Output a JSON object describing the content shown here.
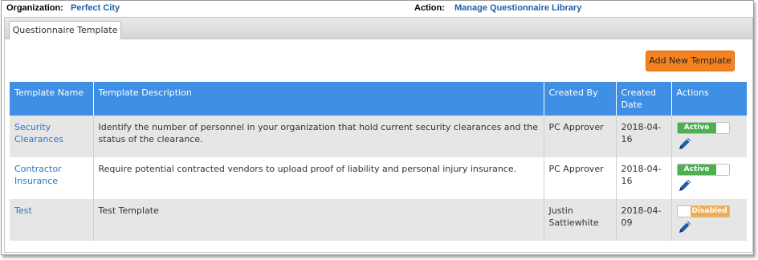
{
  "header": {
    "org_label": "Organization:",
    "org_value": "Perfect City",
    "action_label": "Action:",
    "action_value": "Manage Questionnaire Library"
  },
  "tabs": [
    {
      "label": "Questionnaire Template",
      "active": true
    }
  ],
  "toolbar": {
    "add_label": "Add New Template"
  },
  "table": {
    "columns": [
      "Template Name",
      "Template Description",
      "Created By",
      "Created Date",
      "Actions"
    ],
    "rows": [
      {
        "name": "Security Clearances",
        "description": "Identify the number of personnel in your organization that hold current security clearances and the status of the clearance.",
        "created_by": "PC Approver",
        "created_date": "2018-04-16",
        "status": "Active",
        "status_on": true
      },
      {
        "name": "Contractor Insurance",
        "description": "Require potential contracted vendors to upload proof of liability and personal injury insurance.",
        "created_by": "PC Approver",
        "created_date": "2018-04-16",
        "status": "Active",
        "status_on": true
      },
      {
        "name": "Test",
        "description": "Test Template",
        "created_by": "Justin Sattiewhite",
        "created_date": "2018-04-09",
        "status": "Disabled",
        "status_on": false
      }
    ]
  },
  "icons": {
    "edit": "pencil-edit-icon"
  },
  "colors": {
    "header_bg": "#3f8fe4",
    "link": "#2a75c9",
    "active": "#4caf50",
    "disabled": "#f0ad4e",
    "add_button": "#f58220"
  }
}
